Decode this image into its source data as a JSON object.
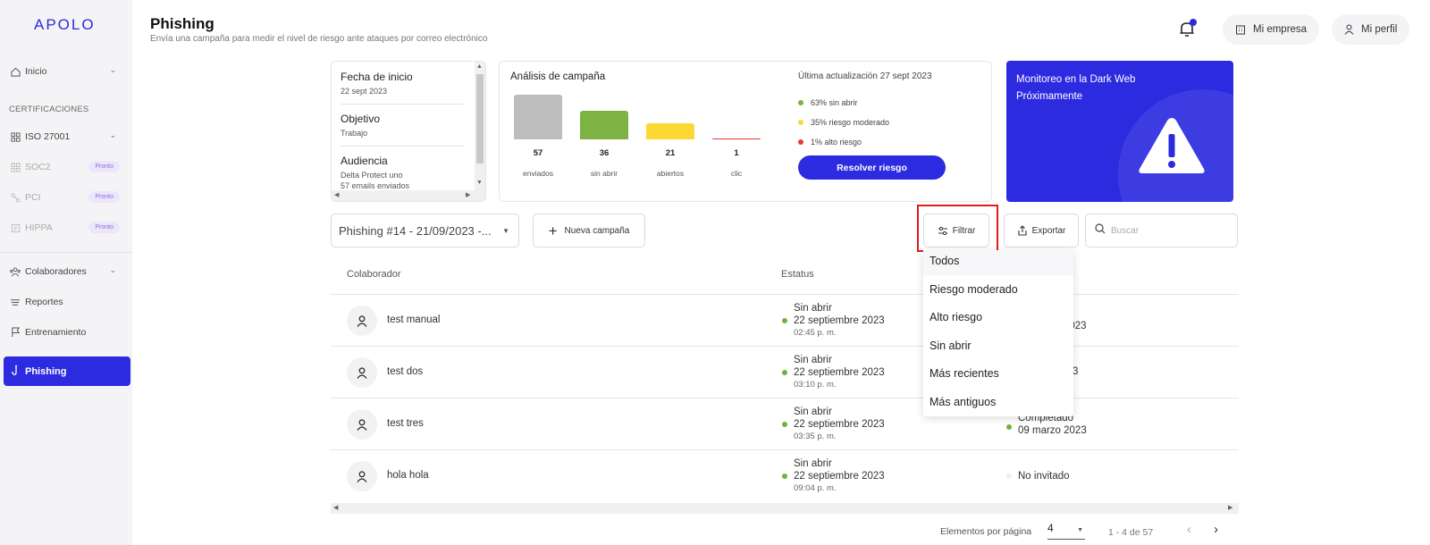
{
  "app": {
    "logo": "APOLO"
  },
  "sidebar": {
    "inicio": "Inicio",
    "section_label": "CERTIFICACIONES",
    "certs": [
      {
        "label": "ISO 27001",
        "badge": ""
      },
      {
        "label": "SOC2",
        "badge": "Pronto"
      },
      {
        "label": "PCI",
        "badge": "Pronto"
      },
      {
        "label": "HIPPA",
        "badge": "Pronto"
      }
    ],
    "colaboradores": "Colaboradores",
    "reportes": "Reportes",
    "entrenamiento": "Entrenamiento",
    "phishing": "Phishing"
  },
  "header": {
    "title": "Phishing",
    "subtitle": "Envía una campaña para medir el nivel de riesgo ante ataques por correo electrónico",
    "company_btn": "Mi empresa",
    "profile_btn": "Mi perfil"
  },
  "campaign_info": {
    "start_label": "Fecha de inicio",
    "start_value": "22 sept 2023",
    "objective_label": "Objetivo",
    "objective_value": "Trabajo",
    "audience_label": "Audiencia",
    "audience_value": "Delta Protect uno",
    "audience_extra": "57 emails enviados"
  },
  "analysis": {
    "title": "Análisis de campaña",
    "last_update": "Última actualización 27 sept 2023",
    "bars": [
      {
        "value": "57",
        "label": "enviados",
        "color": "#bdbdbd",
        "num": 57
      },
      {
        "value": "36",
        "label": "sin abrir",
        "color": "#7cb342",
        "num": 36
      },
      {
        "value": "21",
        "label": "abiertos",
        "color": "#fdd835",
        "num": 21
      },
      {
        "value": "1",
        "label": "clic",
        "color": "#e53935",
        "num": 1
      }
    ],
    "legend": [
      {
        "text": "63% sin abrir",
        "color": "#7cb342"
      },
      {
        "text": "35% riesgo moderado",
        "color": "#fdd835"
      },
      {
        "text": "1% alto riesgo",
        "color": "#e53935"
      }
    ],
    "resolve_btn": "Resolver riesgo"
  },
  "darkweb": {
    "title": "Monitoreo en la Dark Web",
    "subtitle": "Próximamente"
  },
  "toolbar": {
    "campaign_select": "Phishing #14 - 21/09/2023 -...",
    "new_campaign": "Nueva campaña",
    "filter": "Filtrar",
    "export": "Exportar",
    "search_placeholder": "Buscar"
  },
  "filter_menu": [
    "Todos",
    "Riesgo moderado",
    "Alto riesgo",
    "Sin abrir",
    "Más recientes",
    "Más antiguos"
  ],
  "table": {
    "headers": [
      "Colaborador",
      "Estatus"
    ],
    "rows": [
      {
        "name": "test manual",
        "status": "Sin abrir",
        "date": "22 septiembre 2023",
        "time": "02:45 p. m.",
        "col3_a": "o",
        "col3_b": "2023",
        "col3_dot": ""
      },
      {
        "name": "test dos",
        "status": "Sin abrir",
        "date": "22 septiembre 2023",
        "time": "03:10 p. m.",
        "col3_a": "",
        "col3_b": "3",
        "col3_dot": ""
      },
      {
        "name": "test tres",
        "status": "Sin abrir",
        "date": "22 septiembre 2023",
        "time": "03:35 p. m.",
        "col3_a": "Completado",
        "col3_b": "09 marzo 2023",
        "col3_dot": "#6db33f"
      },
      {
        "name": "hola hola",
        "status": "Sin abrir",
        "date": "22 septiembre 2023",
        "time": "09:04 p. m.",
        "col3_a": "No invitado",
        "col3_b": "",
        "col3_dot": "#eeeeee"
      }
    ]
  },
  "pagination": {
    "label": "Elementos por página",
    "per_page": "4",
    "range": "1 - 4 de 57"
  }
}
